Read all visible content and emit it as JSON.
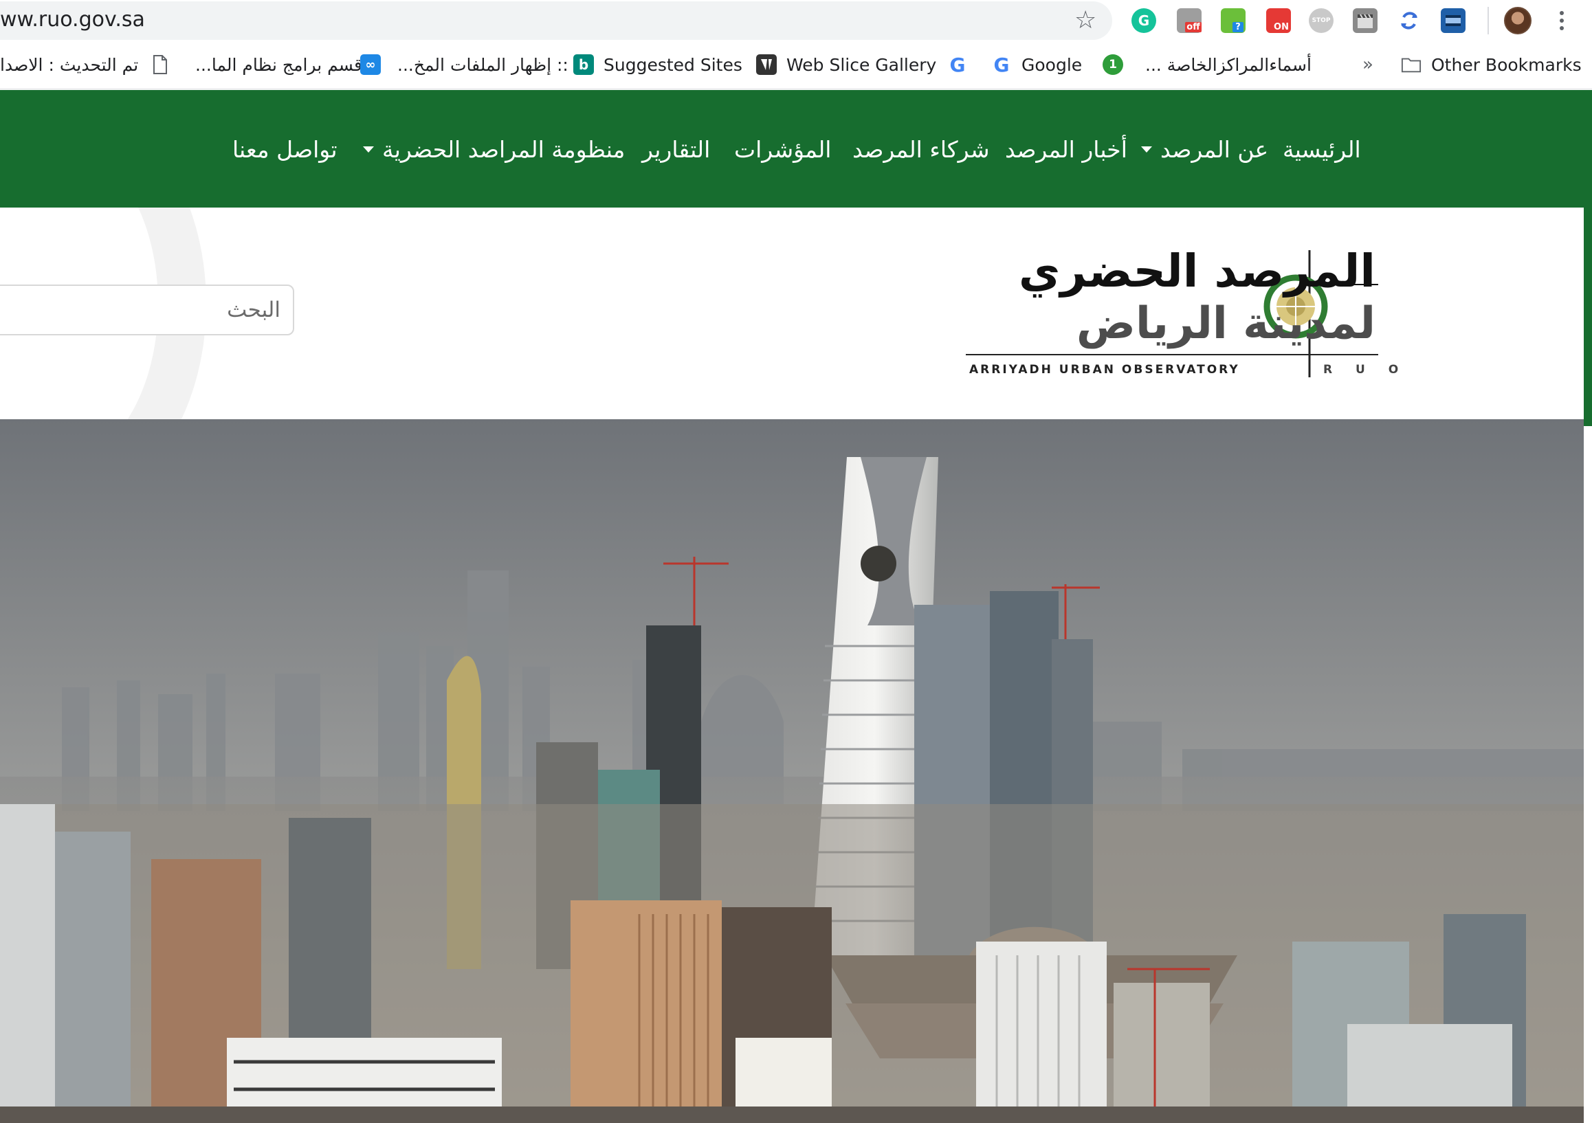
{
  "browser": {
    "url": "ww.ruo.gov.sa",
    "extensions": [
      {
        "name": "grammarly-icon",
        "label": "G",
        "color": "#15c39a"
      },
      {
        "name": "extension-off-icon",
        "label": "off",
        "color": "#9e9e9e"
      },
      {
        "name": "download-help-icon",
        "label": "?",
        "color": "#6bbf3a"
      },
      {
        "name": "extension-on-icon",
        "label": "ON",
        "color": "#e53935"
      },
      {
        "name": "stop-icon",
        "label": "STOP",
        "color": "#c9c9c9"
      },
      {
        "name": "clapper-icon",
        "label": "",
        "color": "#8a8a8a"
      },
      {
        "name": "sync-icon",
        "label": "",
        "color": "#3b6fd8"
      },
      {
        "name": "film-icon",
        "label": "",
        "color": "#1f5fa8"
      }
    ]
  },
  "bookmarks": {
    "items": [
      {
        "name": "bookmark-update",
        "label": "تم التحديث : الاصدا",
        "icon": "",
        "color": ""
      },
      {
        "name": "bookmark-programs",
        "label": "قسم برامج نظام الما...",
        "icon": "page-icon",
        "color": "#ffffff"
      },
      {
        "name": "bookmark-hidden-files",
        "label": ":: إظهار الملفات المخ...",
        "icon": "infinity-icon",
        "color": "#1e88e5"
      },
      {
        "name": "bookmark-suggested-sites",
        "label": "Suggested Sites",
        "icon": "bing-icon",
        "color": "#00897b"
      },
      {
        "name": "bookmark-web-slice-gallery",
        "label": "Web Slice Gallery",
        "icon": "web-slice-icon",
        "color": "#333333"
      },
      {
        "name": "bookmark-google-g",
        "label": "",
        "icon": "google-icon",
        "color": "#ffffff"
      },
      {
        "name": "bookmark-google",
        "label": "Google",
        "icon": "google-icon",
        "color": "#ffffff"
      },
      {
        "name": "bookmark-centers",
        "label": "أسماءالمراكزالخاصة ...",
        "icon": "number-one-icon",
        "color": "#2e9d3a"
      }
    ],
    "overflow": "»",
    "other": "Other Bookmarks"
  },
  "nav": {
    "home": "الرئيسية",
    "about": "عن المرصد",
    "news": "أخبار المرصد",
    "partners": "شركاء المرصد",
    "indicators": "المؤشرات",
    "reports": "التقارير",
    "observatories": "منظومة المراصد الحضرية",
    "contact": "تواصل معنا"
  },
  "header": {
    "search_placeholder": "البحث",
    "logo": {
      "line1": "المرصد الحضري",
      "line2": "لمدينة الرياض",
      "english": "ARRIYADH URBAN OBSERVATORY",
      "abbr": "R U O"
    }
  },
  "colors": {
    "nav_green": "#176d2f",
    "logo_green": "#2f7d32"
  }
}
